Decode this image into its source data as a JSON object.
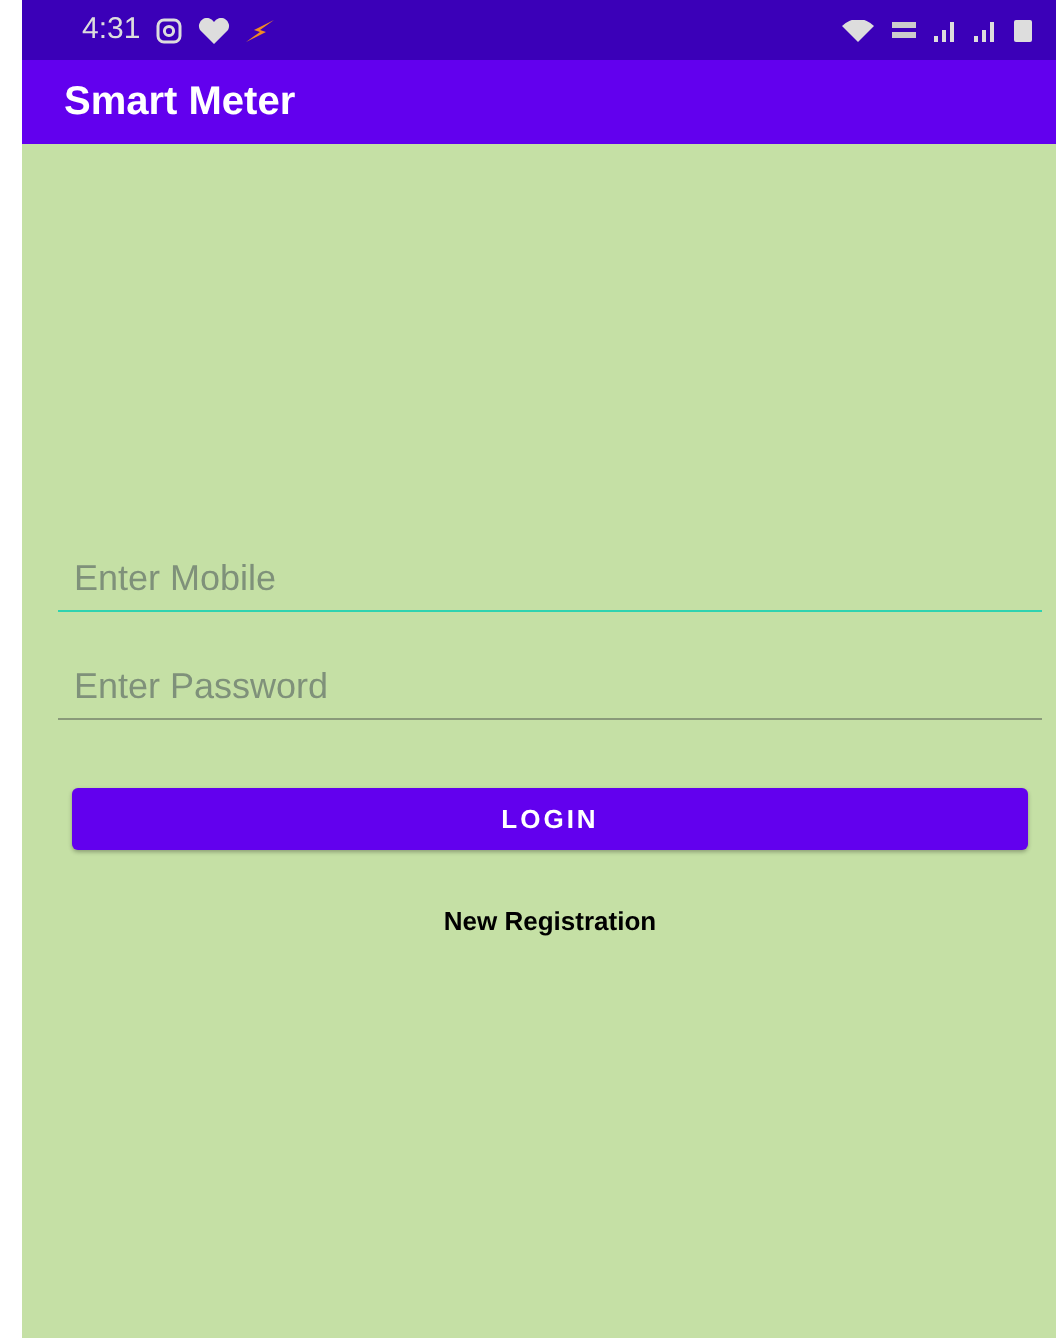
{
  "status_bar": {
    "time": "4:31"
  },
  "app_bar": {
    "title": "Smart Meter"
  },
  "fields": [
    {
      "placeholder": "Enter Mobile",
      "focused": true
    },
    {
      "placeholder": "Enter Password",
      "focused": false
    }
  ],
  "login_button": {
    "label": "LOGIN"
  },
  "register_link": {
    "label": "New Registration"
  }
}
